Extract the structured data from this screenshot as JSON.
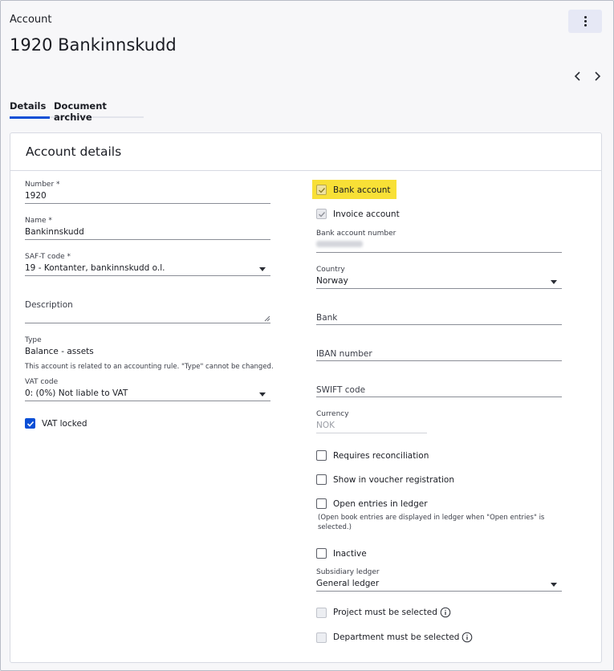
{
  "header": {
    "breadcrumb": "Account",
    "title": "1920 Bankinnskudd"
  },
  "tabs": [
    {
      "label": "Details",
      "active": true
    },
    {
      "label": "Document archive",
      "active": false
    }
  ],
  "card": {
    "title": "Account details"
  },
  "left": {
    "number": {
      "label": "Number *",
      "value": "1920"
    },
    "name": {
      "label": "Name *",
      "value": "Bankinnskudd"
    },
    "saft": {
      "label": "SAF-T code *",
      "value": "19 - Kontanter, bankinnskudd o.l."
    },
    "description": {
      "placeholder": "Description"
    },
    "type": {
      "label": "Type",
      "value": "Balance - assets",
      "note": "This account is related to an accounting rule. \"Type\" cannot be changed."
    },
    "vat_code": {
      "label": "VAT code",
      "value": "0: (0%) Not liable to VAT"
    },
    "vat_locked": {
      "label": "VAT locked",
      "checked": true
    }
  },
  "right": {
    "bank_account": {
      "label": "Bank account",
      "checked": true,
      "disabled": true
    },
    "invoice_account": {
      "label": "Invoice account",
      "checked": true,
      "disabled": true
    },
    "bank_account_number": {
      "label": "Bank account number"
    },
    "country": {
      "label": "Country",
      "value": "Norway"
    },
    "bank": {
      "placeholder": "Bank"
    },
    "iban": {
      "placeholder": "IBAN number"
    },
    "swift": {
      "placeholder": "SWIFT code"
    },
    "currency": {
      "label": "Currency",
      "value": "NOK"
    },
    "requires_reconciliation": {
      "label": "Requires reconciliation",
      "checked": false
    },
    "show_in_voucher": {
      "label": "Show in voucher registration",
      "checked": false
    },
    "open_entries": {
      "label": "Open entries in ledger",
      "checked": false,
      "note": "(Open book entries are displayed in ledger when \"Open entries\" is selected.)"
    },
    "inactive": {
      "label": "Inactive",
      "checked": false
    },
    "subsidiary_ledger": {
      "label": "Subsidiary ledger",
      "value": "General ledger"
    },
    "project_required": {
      "label": "Project must be selected",
      "checked": false,
      "disabled": true
    },
    "department_required": {
      "label": "Department must be selected",
      "checked": false,
      "disabled": true
    }
  },
  "colors": {
    "accent": "#0b4fd6",
    "highlight": "#f8e036",
    "more_button_bg": "#e6e8f5"
  },
  "icons": {
    "more": "more-vertical-icon",
    "prev": "chevron-left-icon",
    "next": "chevron-right-icon",
    "caret": "caret-down-icon",
    "info": "info-icon",
    "check": "checkmark-icon"
  }
}
